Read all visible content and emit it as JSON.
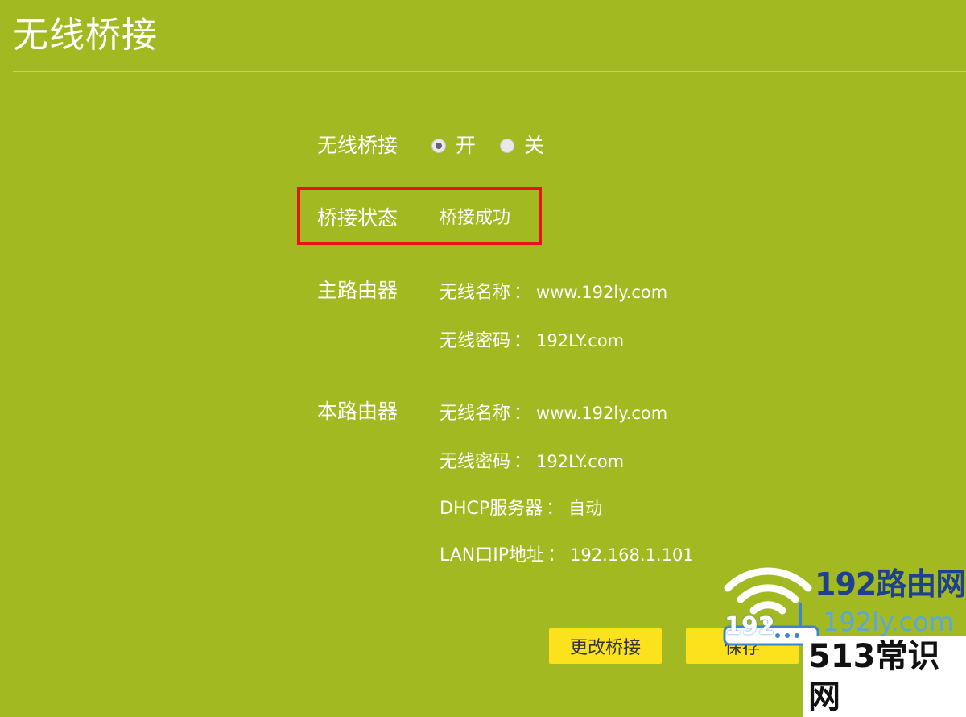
{
  "page": {
    "title": "无线桥接"
  },
  "bridge": {
    "label": "无线桥接",
    "option_on": "开",
    "option_off": "关",
    "selected": "开"
  },
  "status": {
    "label": "桥接状态",
    "value": "桥接成功"
  },
  "main_router": {
    "label": "主路由器",
    "ssid_key": "无线名称",
    "ssid": "www.192ly.com",
    "password_key": "无线密码",
    "password": "192LY.com"
  },
  "local_router": {
    "label": "本路由器",
    "ssid_key": "无线名称",
    "ssid": "www.192ly.com",
    "password_key": "无线密码",
    "password": "192LY.com",
    "dhcp_key": "DHCP服务器",
    "dhcp": "自动",
    "lan_ip_key": "LAN口IP地址",
    "lan_ip": "192.168.1.101"
  },
  "separator": "：",
  "buttons": {
    "change": "更改桥接",
    "save": "保存"
  },
  "watermark": {
    "brand": "192路由网",
    "domain": "192ly.com",
    "icon_text": "192",
    "footer": "513常识网"
  },
  "colors": {
    "background": "#a3b921",
    "highlight_border": "#e8121a",
    "button": "#fbe21d",
    "radio_dot": "#6a5b80"
  },
  "icons": [
    "radio-on",
    "radio-off",
    "wifi-router-logo-icon"
  ]
}
